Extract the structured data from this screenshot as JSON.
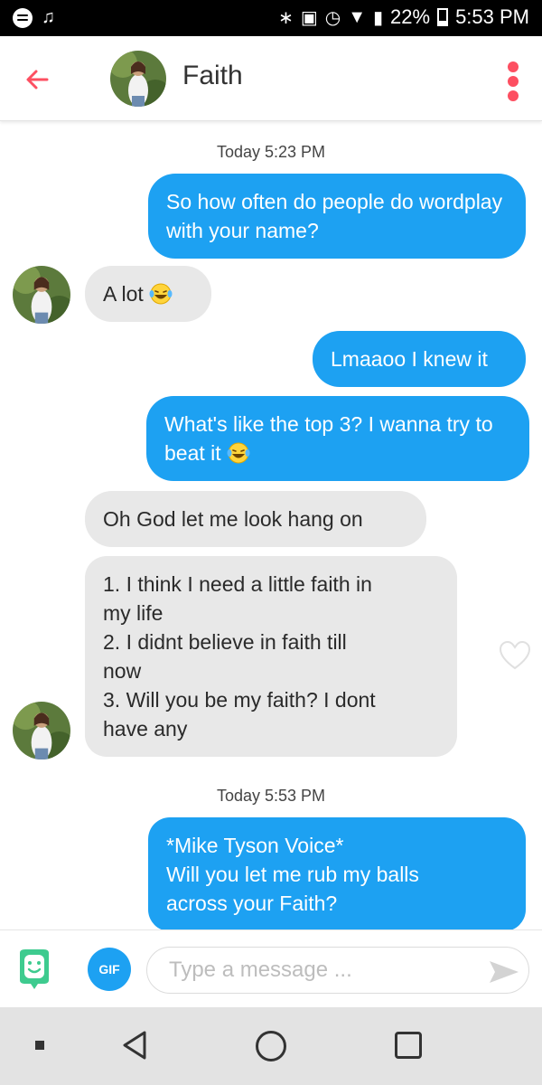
{
  "status_bar": {
    "battery": "22%",
    "time": "5:53 PM",
    "left_icons": [
      "spotify-icon",
      "notification-icon"
    ],
    "right_icons": [
      "bluetooth-icon",
      "nfc-icon",
      "alarm-icon",
      "wifi-icon",
      "signal-icon",
      "battery-icon"
    ]
  },
  "header": {
    "name": "Faith",
    "back_icon": "back-arrow-icon",
    "menu_icon": "more-vertical-icon",
    "accent_color": "#fd4f61"
  },
  "conversation": {
    "timestamps": [
      "Today 5:23 PM",
      "Today 5:53 PM"
    ],
    "messages": [
      {
        "from": "me",
        "text": "So how often do people do wordplay with your name?"
      },
      {
        "from": "them",
        "text": "A lot",
        "emoji": "laughing-emoji"
      },
      {
        "from": "me",
        "text": "Lmaaoo I knew it"
      },
      {
        "from": "me",
        "text": "What's like the top 3? I wanna try to beat it",
        "emoji": "laughing-emoji"
      },
      {
        "from": "them",
        "text": "Oh God let me look hang on"
      },
      {
        "from": "them",
        "lines": [
          "1. I think I need a little faith in",
          "my life",
          "2. I didnt believe in faith till",
          "now",
          "3. Will you be my faith? I dont",
          "have any"
        ]
      },
      {
        "from": "me",
        "lines": [
          "*Mike Tyson Voice*",
          "Will you let me rub my balls",
          "across your Faith?"
        ]
      }
    ],
    "outgoing_color": "#1da1f2",
    "incoming_color": "#e8e8e8"
  },
  "composer": {
    "gif_label": "GIF",
    "placeholder": "Type a message ...",
    "value": ""
  }
}
